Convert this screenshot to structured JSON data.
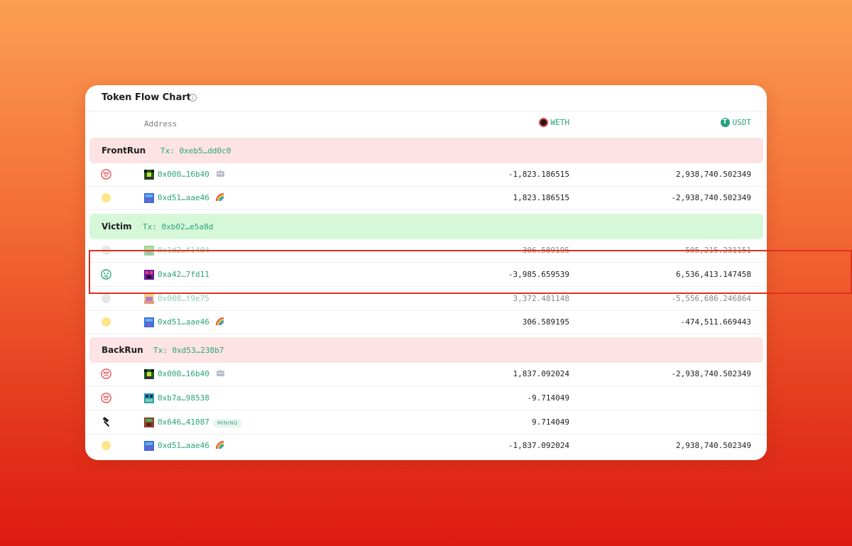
{
  "card": {
    "title": "Token Flow Chart",
    "info_icon_glyph": "i"
  },
  "columns": {
    "address": "Address",
    "token1": "WETH",
    "token2": "USDT",
    "token2_icon_glyph": "T"
  },
  "colors": {
    "accent_green": "#2aa37a",
    "frontrun_bg": "#fde3e3",
    "victim_bg": "#d6f8d9",
    "backrun_bg": "#fde3e3",
    "highlight": "#e0301e"
  },
  "sections": [
    {
      "name": "FrontRun",
      "tx": "Tx: 0xeb5…dd0c0",
      "rows": [
        {
          "icon": "bot-face-icon",
          "address": "0x000…16b40",
          "badge": "robot-icon",
          "weth": "-1,823.186515",
          "usdt": "2,938,740.502349"
        },
        {
          "icon": "yellow-dot",
          "address": "0xd51…aae46",
          "badge": "rainbow-icon",
          "weth": "1,823.186515",
          "usdt": "-2,938,740.502349"
        }
      ]
    },
    {
      "name": "Victim",
      "tx": "Tx: 0xb02…e5a8d",
      "rows": [
        {
          "icon": "grey-dot",
          "address": "0x1d2…f1404",
          "badge": "",
          "weth": "306.589195",
          "usdt": "-505,215.231151"
        },
        {
          "icon": "victim-face-icon",
          "address": "0xa42…7fd11",
          "badge": "",
          "weth": "-3,985.659539",
          "usdt": "6,536,413.147458"
        },
        {
          "icon": "grey-dot",
          "address": "0x000…f9e75",
          "badge": "",
          "weth": "3,372.481148",
          "usdt": "-5,556,686.246864"
        },
        {
          "icon": "yellow-dot",
          "address": "0xd51…aae46",
          "badge": "rainbow-icon",
          "weth": "306.589195",
          "usdt": "-474,511.669443"
        }
      ]
    },
    {
      "name": "BackRun",
      "tx": "Tx: 0xd53…238b7",
      "rows": [
        {
          "icon": "bot-face-icon",
          "address": "0x000…16b40",
          "badge": "robot-icon",
          "weth": "1,837.092024",
          "usdt": "-2,938,740.502349"
        },
        {
          "icon": "bot-face-icon",
          "address": "0xb7a…98538",
          "badge": "",
          "weth": "-9.714049",
          "usdt": ""
        },
        {
          "icon": "hammer-icon",
          "address": "0x646…41087",
          "badge": "MINING",
          "weth": "9.714049",
          "usdt": ""
        },
        {
          "icon": "yellow-dot",
          "address": "0xd51…aae46",
          "badge": "rainbow-icon",
          "weth": "-1,837.092024",
          "usdt": "2,938,740.502349"
        }
      ]
    }
  ]
}
